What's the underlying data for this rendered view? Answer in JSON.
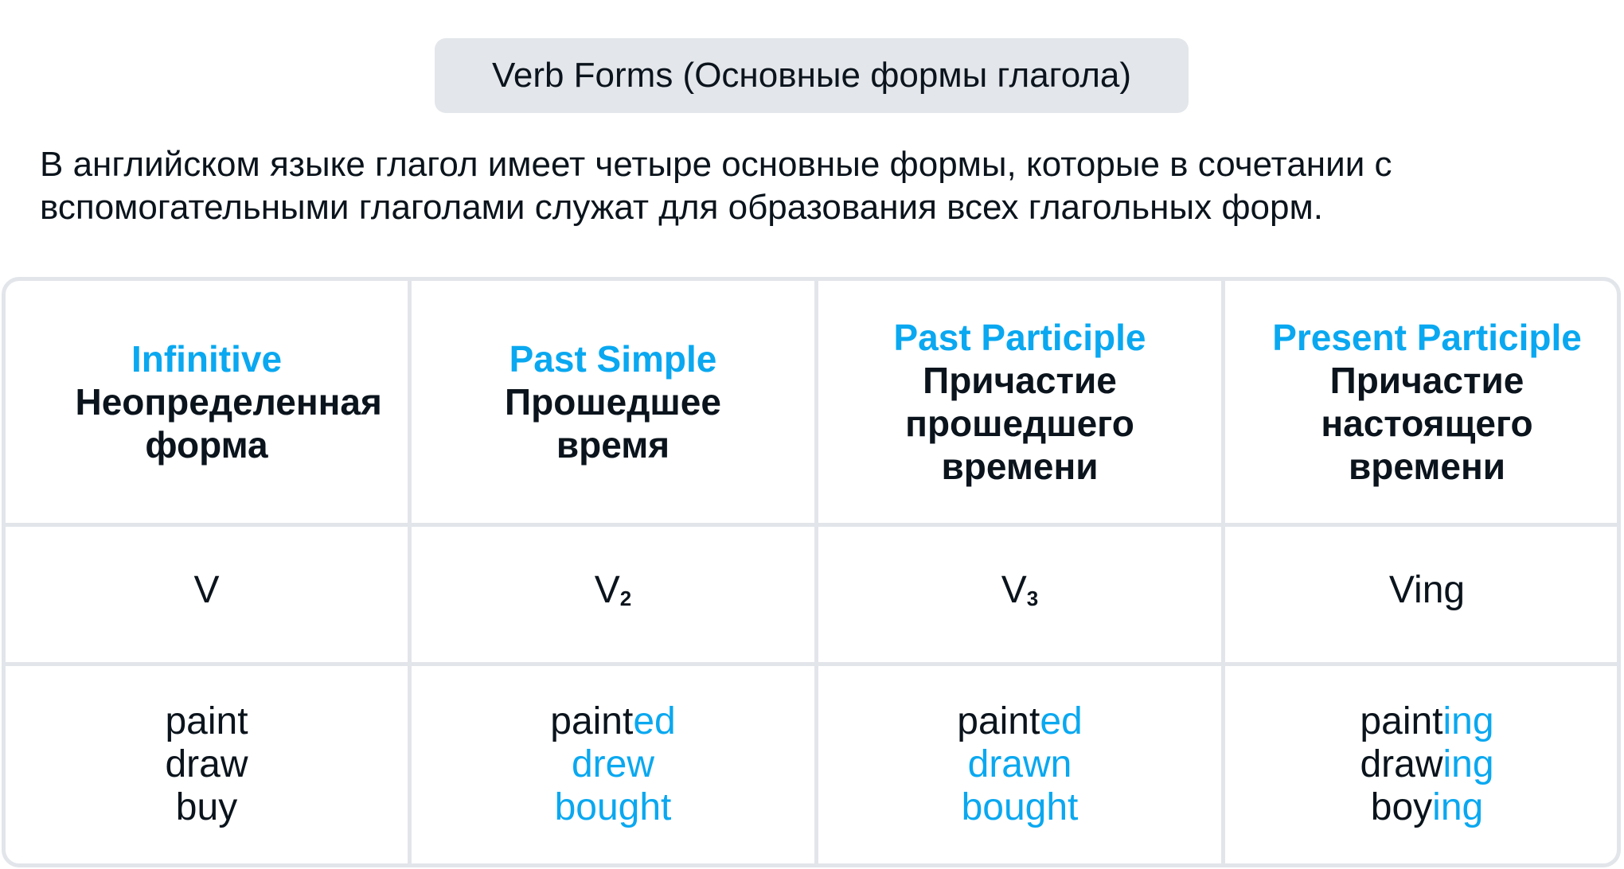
{
  "title": "Verb Forms (Основные формы глагола)",
  "intro": "В английском языке глагол имеет четыре основные формы, которые в сочетании с вспомогательными глаголами служат для образования всех глагольных форм.",
  "colors": {
    "accent": "#0aa8f0",
    "text": "#0b141c",
    "border": "#e2e5ea",
    "badge_bg": "#e3e6ea"
  },
  "table": {
    "columns": [
      {
        "header_en": "Infinitive",
        "header_ru": "Неопределенная форма",
        "formula_base": "V",
        "formula_sub": "",
        "examples": [
          {
            "base": "paint",
            "suffix": ""
          },
          {
            "base": "draw",
            "suffix": ""
          },
          {
            "base": "buy",
            "suffix": ""
          }
        ]
      },
      {
        "header_en": "Past Simple",
        "header_ru": "Прошедшее время",
        "formula_base": "V",
        "formula_sub": "2",
        "examples": [
          {
            "base": "paint",
            "suffix": "ed"
          },
          {
            "base": "",
            "suffix": "drew"
          },
          {
            "base": "",
            "suffix": "bought"
          }
        ]
      },
      {
        "header_en": "Past Participle",
        "header_ru": "Причастие прошедшего времени",
        "formula_base": "V",
        "formula_sub": "3",
        "examples": [
          {
            "base": "paint",
            "suffix": "ed"
          },
          {
            "base": "",
            "suffix": "drawn"
          },
          {
            "base": "",
            "suffix": "bought"
          }
        ]
      },
      {
        "header_en": "Present Participle",
        "header_ru": "Причастие настоящего времени",
        "formula_base": "Ving",
        "formula_sub": "",
        "examples": [
          {
            "base": "paint",
            "suffix": "ing"
          },
          {
            "base": "draw",
            "suffix": "ing"
          },
          {
            "base": "boy",
            "suffix": "ing"
          }
        ]
      }
    ]
  }
}
